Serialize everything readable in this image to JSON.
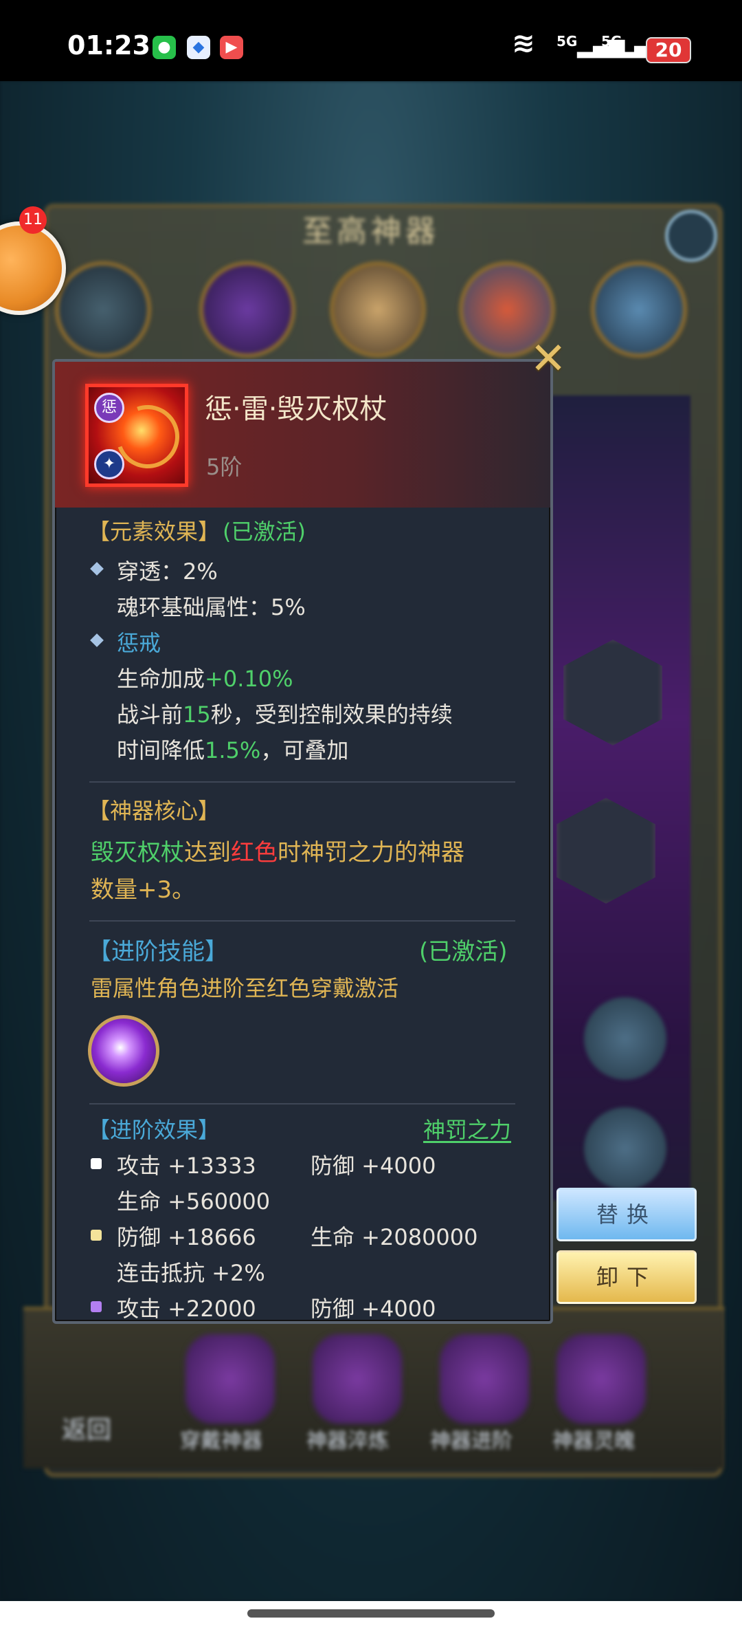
{
  "status_bar": {
    "time": "01:23",
    "signal1": "5G",
    "signal2": "5G",
    "battery": "20"
  },
  "bubble": {
    "badge": "11"
  },
  "background": {
    "title": "至高神器",
    "bottom_back": "返回",
    "bottom_labels": [
      "穿戴神器",
      "神器淬炼",
      "神器进阶",
      "神器灵魄"
    ]
  },
  "tooltip": {
    "name": "惩·雷·毁灭权杖",
    "rank": "5阶",
    "rune_top": "惩",
    "element_section": {
      "title": "【元素效果】",
      "status": "(已激活)",
      "stat1": "穿透：2%",
      "stat2": "魂环基础属性：5%",
      "effect_name": "惩戒",
      "effect_line1_prefix": "生命加成",
      "effect_line1_value": "+0.10%",
      "effect_line2_a": "战斗前",
      "effect_line2_b": "15",
      "effect_line2_c": "秒，受到控制效果的持续",
      "effect_line3_a": "时间降低",
      "effect_line3_b": "1.5%",
      "effect_line3_c": "，可叠加"
    },
    "core_section": {
      "title": "【神器核心】",
      "line1_a": "毁灭权杖",
      "line1_b": "达到",
      "line1_c": "红色",
      "line1_d": "时神罚之力的神器",
      "line2": "数量+3。"
    },
    "skill_section": {
      "title": "【进阶技能】",
      "status": "(已激活)",
      "desc": "雷属性角色进阶至红色穿戴激活"
    },
    "advance_section": {
      "title": "【进阶效果】",
      "link": "神罚之力",
      "rows": [
        {
          "bullet_color": "#ffffff",
          "a": "攻击 +13333",
          "b": "防御 +4000",
          "c": "生命 +560000"
        },
        {
          "bullet_color": "#f3e39a",
          "a": "防御 +18666",
          "b": "生命 +2080000",
          "c": "连击抵抗 +2%"
        },
        {
          "bullet_color": "#b37ff0",
          "a": "攻击 +22000",
          "b": "防御 +4000"
        }
      ]
    }
  },
  "buttons": {
    "replace": "替换",
    "unequip": "卸下"
  }
}
